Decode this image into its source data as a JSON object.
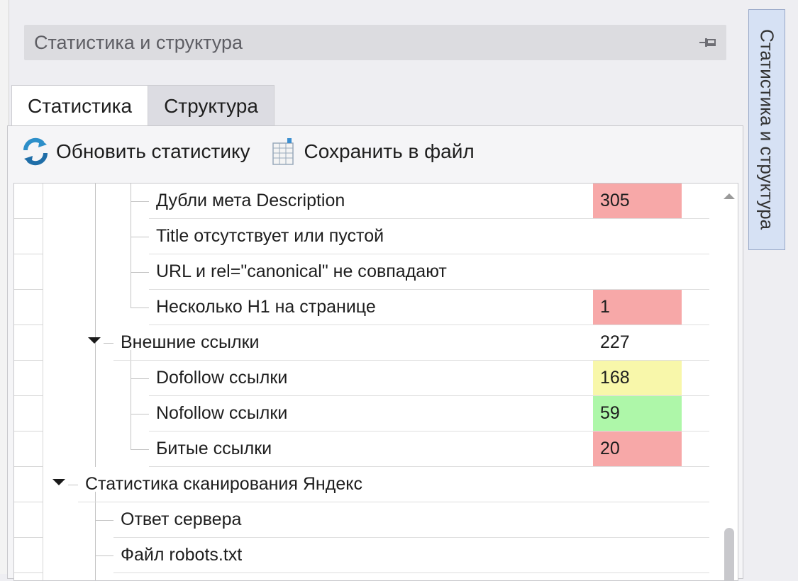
{
  "panel": {
    "title": "Статистика и структура"
  },
  "tabs": [
    {
      "label": "Статистика",
      "active": true
    },
    {
      "label": "Структура",
      "active": false
    }
  ],
  "toolbar": {
    "refresh_label": "Обновить статистику",
    "refresh_icon": "refresh-icon",
    "save_label": "Сохранить в файл",
    "save_icon": "spreadsheet-icon"
  },
  "tree_rows": [
    {
      "label": "Дубли мета Description",
      "value": "305",
      "status": "error"
    },
    {
      "label": "Title отсутствует или пустой",
      "value": "",
      "status": "none"
    },
    {
      "label": "URL и rel=\"canonical\" не совпадают",
      "value": "",
      "status": "none"
    },
    {
      "label": "Несколько H1 на странице",
      "value": "1",
      "status": "error"
    },
    {
      "label": "Внешние ссылки",
      "value": "227",
      "status": "none",
      "expanded": true
    },
    {
      "label": "Dofollow ссылки",
      "value": "168",
      "status": "warning"
    },
    {
      "label": "Nofollow ссылки",
      "value": "59",
      "status": "ok"
    },
    {
      "label": "Битые ссылки",
      "value": "20",
      "status": "error"
    },
    {
      "label": "Статистика сканирования Яндекс",
      "value": "",
      "status": "none",
      "expanded": true
    },
    {
      "label": "Ответ сервера",
      "value": "",
      "status": "none"
    },
    {
      "label": "Файл robots.txt",
      "value": "",
      "status": "none"
    }
  ],
  "colors": {
    "error": "#f7a8a8",
    "warning": "#f8f7aa",
    "ok": "#aef7a9"
  },
  "side_tab": {
    "label": "Статистика и структура"
  }
}
